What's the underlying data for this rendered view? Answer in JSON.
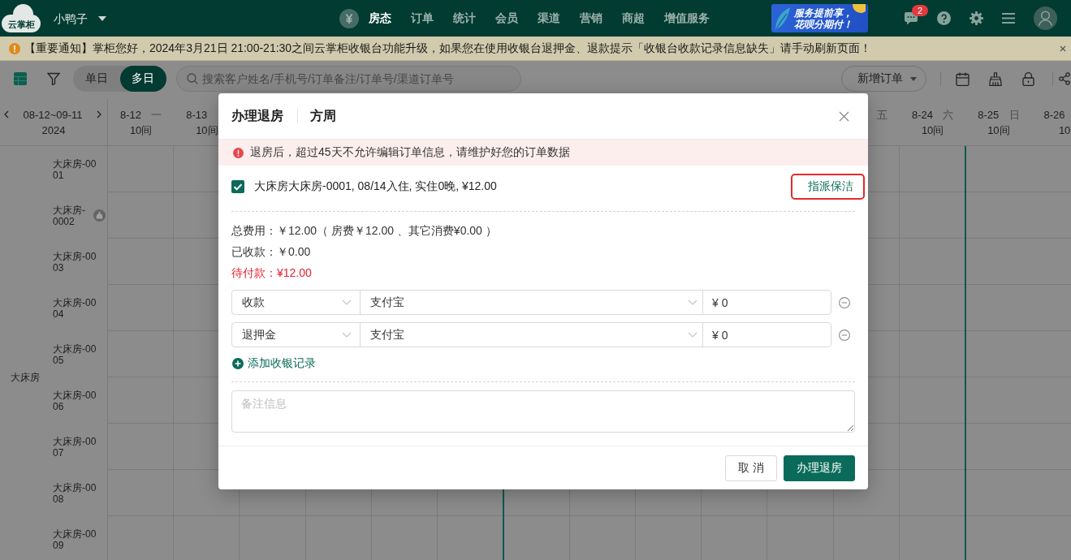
{
  "topbar": {
    "logo": "云掌柜",
    "hotel": "小鸭子",
    "nav": [
      {
        "label": "房态",
        "selected": true
      },
      {
        "label": "订单",
        "selected": false
      },
      {
        "label": "统计",
        "selected": false
      },
      {
        "label": "会员",
        "selected": false
      },
      {
        "label": "渠道",
        "selected": false
      },
      {
        "label": "营销",
        "selected": false
      },
      {
        "label": "商超",
        "selected": false
      },
      {
        "label": "增值服务",
        "selected": false
      }
    ],
    "banner": [
      "服务提前享，",
      "花呗分期付！"
    ],
    "message_count": "2"
  },
  "notice": {
    "text": "【重要通知】掌柜您好，2024年3月21日 21:00-21:30之间云掌柜收银台功能升级，如果您在使用收银台退押金、退款提示「收银台收款记录信息缺失」请手动刷新页面！"
  },
  "toolbar": {
    "view_modes": [
      {
        "label": "单日",
        "selected": false
      },
      {
        "label": "多日",
        "selected": true
      }
    ],
    "search": {
      "placeholder": "搜索客户姓名/手机号/订单备注/订单号/渠道订单号"
    },
    "new_order": "新增订单"
  },
  "calendar": {
    "range": "08-12~09-11",
    "year": "2024",
    "columns_left": [
      {
        "date": "8-12",
        "weekday": "一",
        "rooms": "10间"
      },
      {
        "date": "8-13",
        "rooms": "10间"
      }
    ],
    "columns_right": [
      {
        "weekday": "五"
      },
      {
        "date": "8-24",
        "weekday": "六",
        "rooms": "10间"
      },
      {
        "date": "8-25",
        "weekday": "日",
        "rooms": "10间"
      },
      {
        "date": "8-26",
        "rooms": "10"
      }
    ],
    "room_type": "大床房",
    "rooms": [
      {
        "name": "大床房-0001",
        "dirty": false
      },
      {
        "name": "大床房-0002",
        "dirty": true
      },
      {
        "name": "大床房-0003",
        "dirty": false
      },
      {
        "name": "大床房-0004",
        "dirty": false
      },
      {
        "name": "大床房-0005",
        "dirty": false
      },
      {
        "name": "大床房-0006",
        "dirty": false
      },
      {
        "name": "大床房-0007",
        "dirty": false
      },
      {
        "name": "大床房-0008",
        "dirty": false
      },
      {
        "name": "大床房-0009",
        "dirty": false
      }
    ]
  },
  "dialog": {
    "title": "办理退房",
    "guest": "方周",
    "alert": "退房后，超过45天不允许编辑订单信息，请维护好您的订单数据",
    "stay": {
      "checked": true,
      "label": "大床房大床房-0001, 08/14入住, 实住0晚, ¥12.00"
    },
    "assign_cleaning": {
      "label": "指派保洁",
      "highlighted": true
    },
    "summary": [
      {
        "kind": "normal",
        "text": "总费用：￥12.00（ 房费￥12.00 、其它消费¥0.00 ）"
      },
      {
        "kind": "normal",
        "text": "已收款：￥0.00"
      },
      {
        "kind": "due",
        "text": "待付款：¥12.00"
      }
    ],
    "payments": [
      {
        "type": "收款",
        "method": "支付宝",
        "amount": "¥ 0"
      },
      {
        "type": "退押金",
        "method": "支付宝",
        "amount": "¥ 0"
      }
    ],
    "add_payment": "添加收银记录",
    "remark": {
      "placeholder": "备注信息"
    },
    "buttons": [
      {
        "kind": "secondary",
        "label": "取 消"
      },
      {
        "kind": "primary",
        "label": "办理退房"
      }
    ]
  }
}
